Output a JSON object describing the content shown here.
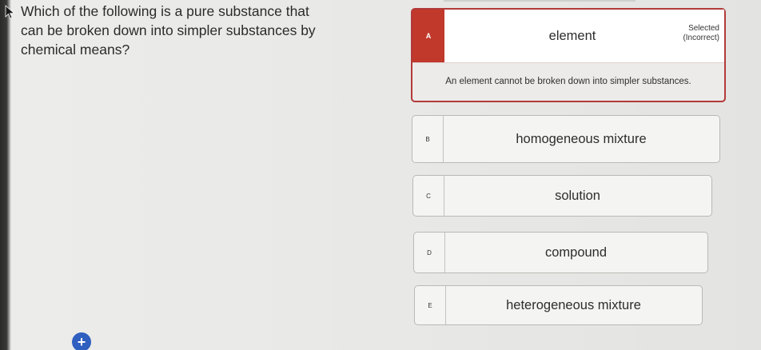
{
  "question": {
    "text": "Which of the following is a pure substance that can be broken down into simpler substances by chemical means?"
  },
  "options": [
    {
      "letter": "A",
      "label": "element",
      "status_line1": "Selected",
      "status_line2": "(Incorrect)",
      "feedback": "An element cannot be broken down into simpler substances.",
      "selected": true,
      "correct": false
    },
    {
      "letter": "B",
      "label": "homogeneous mixture"
    },
    {
      "letter": "C",
      "label": "solution"
    },
    {
      "letter": "D",
      "label": "compound"
    },
    {
      "letter": "E",
      "label": "heterogeneous mixture"
    }
  ],
  "colors": {
    "incorrect": "#c0392b",
    "add_button": "#2f5fbf"
  },
  "icons": {
    "cursor": "mouse-pointer-icon",
    "add": "plus-icon"
  },
  "add_button": {
    "glyph": "+"
  }
}
